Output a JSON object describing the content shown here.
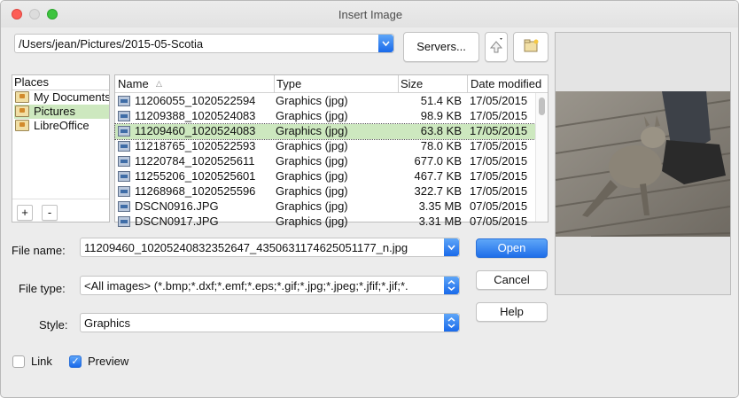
{
  "window": {
    "title": "Insert Image"
  },
  "path_combo": {
    "value": "/Users/jean/Pictures/2015-05-Scotia"
  },
  "toolbar": {
    "servers_label": "Servers..."
  },
  "places": {
    "header": "Places",
    "items": [
      {
        "label": "My Documents"
      },
      {
        "label": "Pictures"
      },
      {
        "label": "LibreOffice"
      }
    ],
    "add_label": "+",
    "remove_label": "-"
  },
  "files": {
    "columns": [
      "Name",
      "Type",
      "Size",
      "Date modified"
    ],
    "rows": [
      {
        "name": "11206055_1020522594",
        "type": "Graphics (jpg)",
        "size": "51.4 KB",
        "date": "17/05/2015"
      },
      {
        "name": "11209388_1020524083",
        "type": "Graphics (jpg)",
        "size": "98.9 KB",
        "date": "17/05/2015"
      },
      {
        "name": "11209460_1020524083",
        "type": "Graphics (jpg)",
        "size": "63.8 KB",
        "date": "17/05/2015"
      },
      {
        "name": "11218765_1020522593",
        "type": "Graphics (jpg)",
        "size": "78.0 KB",
        "date": "17/05/2015"
      },
      {
        "name": "11220784_1020525611",
        "type": "Graphics (jpg)",
        "size": "677.0 KB",
        "date": "17/05/2015"
      },
      {
        "name": "11255206_1020525601",
        "type": "Graphics (jpg)",
        "size": "467.7 KB",
        "date": "17/05/2015"
      },
      {
        "name": "11268968_1020525596",
        "type": "Graphics (jpg)",
        "size": "322.7 KB",
        "date": "17/05/2015"
      },
      {
        "name": "DSCN0916.JPG",
        "type": "Graphics (jpg)",
        "size": "3.35 MB",
        "date": "07/05/2015"
      },
      {
        "name": "DSCN0917.JPG",
        "type": "Graphics (jpg)",
        "size": "3.31 MB",
        "date": "07/05/2015"
      }
    ]
  },
  "form": {
    "file_name_label": "File name:",
    "file_name_value": "11209460_10205240832352647_4350631174625051177_n.jpg",
    "file_type_label": "File type:",
    "file_type_value": "<All images> (*.bmp;*.dxf;*.emf;*.eps;*.gif;*.jpg;*.jpeg;*.jfif;*.jif;*.",
    "style_label": "Style:",
    "style_value": "Graphics"
  },
  "buttons": {
    "open": "Open",
    "cancel": "Cancel",
    "help": "Help"
  },
  "options": {
    "link_label": "Link",
    "link_checked": false,
    "preview_label": "Preview",
    "preview_checked": true
  },
  "colors": {
    "accent": "#1f6ee9",
    "selection": "#cde8bf"
  }
}
